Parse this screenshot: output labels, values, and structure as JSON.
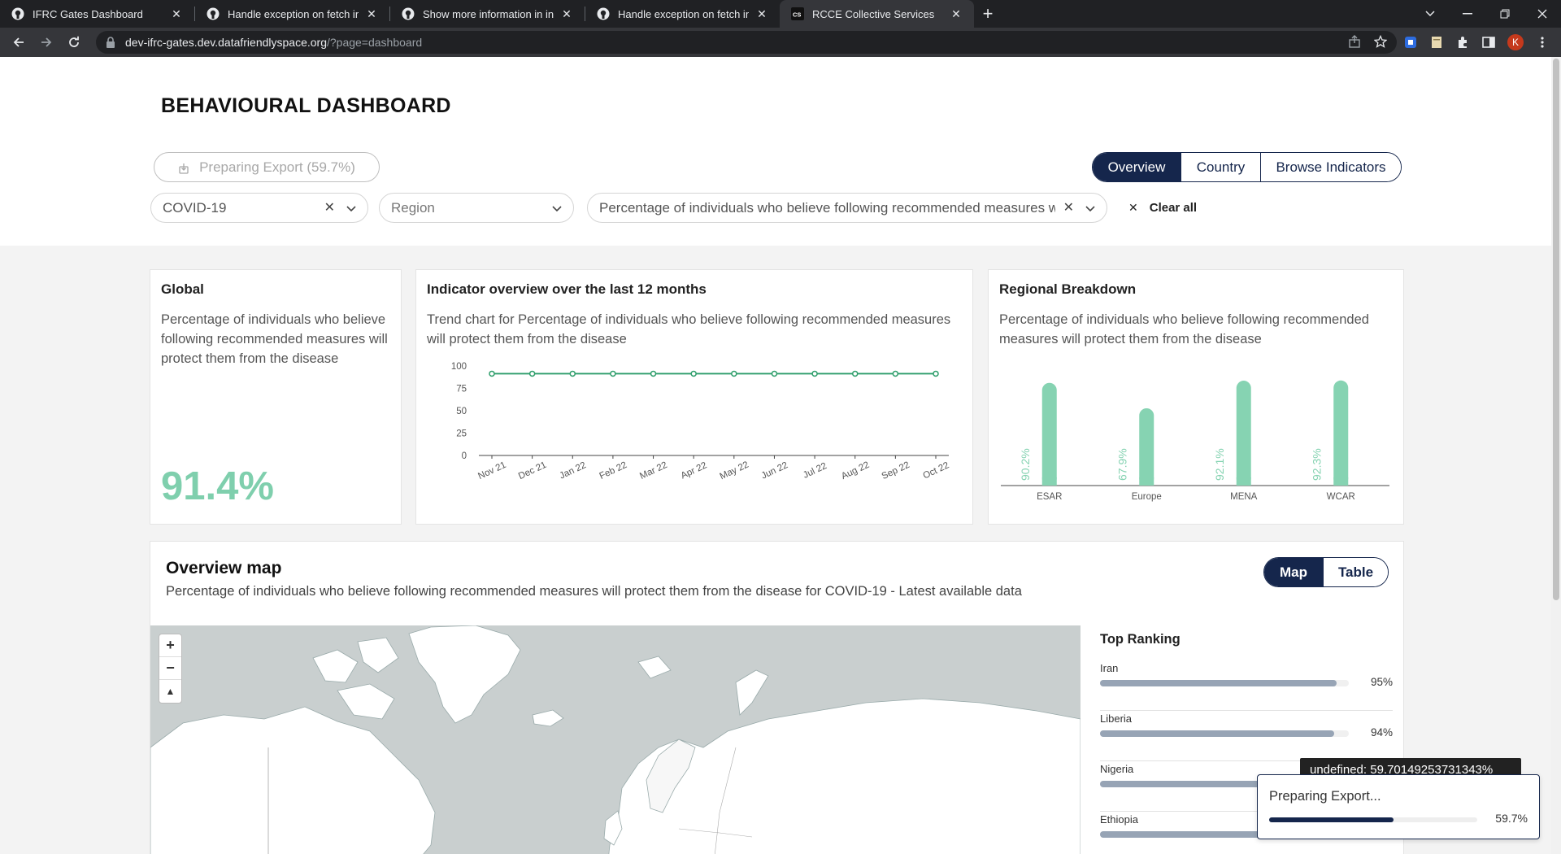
{
  "browser": {
    "tabs": [
      {
        "title": "IFRC Gates Dashboard",
        "icon": "github-icon",
        "active": false
      },
      {
        "title": "Handle exception on fetch inside",
        "icon": "github-icon",
        "active": false
      },
      {
        "title": "Show more information in indica",
        "icon": "github-icon",
        "active": false
      },
      {
        "title": "Handle exception on fetch inside",
        "icon": "github-icon",
        "active": false
      },
      {
        "title": "RCCE Collective Services",
        "icon": "cs-icon",
        "active": true
      }
    ],
    "url_host": "dev-ifrc-gates.dev.datafriendlyspace.org",
    "url_path": "/?page=dashboard",
    "profile_initial": "K"
  },
  "header": {
    "title": "BEHAVIOURAL DASHBOARD",
    "export_label": "Preparing Export (59.7%)",
    "view_tabs": [
      {
        "label": "Overview",
        "active": true
      },
      {
        "label": "Country",
        "active": false
      },
      {
        "label": "Browse Indicators",
        "active": false
      }
    ],
    "filters": {
      "disease": "COVID-19",
      "region_placeholder": "Region",
      "indicator": "Percentage of individuals who believe following recommended measures w"
    },
    "clear_all": "Clear all"
  },
  "global_card": {
    "title": "Global",
    "description": "Percentage of individuals who believe following recommended measures will protect them from the disease",
    "value": "91.4%"
  },
  "trend_card": {
    "title": "Indicator overview over the last 12 months",
    "description": "Trend chart for Percentage of individuals who believe following recommended measures will protect them from the disease"
  },
  "regional_card": {
    "title": "Regional Breakdown",
    "description": "Percentage of individuals who believe following recommended measures will protect them from the disease"
  },
  "chart_data": [
    {
      "type": "line",
      "x": [
        "Nov 21",
        "Dec 21",
        "Jan 22",
        "Feb 22",
        "Mar 22",
        "Apr 22",
        "May 22",
        "Jun 22",
        "Jul 22",
        "Aug 22",
        "Sep 22",
        "Oct 22"
      ],
      "series": [
        {
          "values": [
            91.4,
            91.4,
            91.4,
            91.4,
            91.4,
            91.4,
            91.4,
            91.4,
            91.4,
            91.4,
            91.4,
            91.4
          ]
        }
      ],
      "yticks": [
        0,
        25,
        50,
        75,
        100
      ],
      "ylim": [
        0,
        100
      ],
      "color": "#2e9e6b"
    },
    {
      "type": "bar",
      "categories": [
        "ESAR",
        "Europe",
        "MENA",
        "WCAR"
      ],
      "values": [
        90.2,
        67.9,
        92.1,
        92.3
      ],
      "labels": [
        "90.2%",
        "67.9%",
        "92.1%",
        "92.3%"
      ],
      "ylim": [
        0,
        100
      ],
      "color": "#86d3b2"
    }
  ],
  "map_card": {
    "title": "Overview map",
    "subtitle": "Percentage of individuals who believe following recommended measures will protect them from the disease for COVID-19 - Latest available data",
    "tabs": [
      {
        "label": "Map",
        "active": true
      },
      {
        "label": "Table",
        "active": false
      }
    ],
    "zoom_in": "+",
    "zoom_out": "−",
    "reset_north": "▲"
  },
  "ranking": {
    "title": "Top Ranking",
    "items": [
      {
        "name": "Iran",
        "value": "95%",
        "fraction": 0.95
      },
      {
        "name": "Liberia",
        "value": "94%",
        "fraction": 0.94
      },
      {
        "name": "Nigeria",
        "value": "",
        "fraction": 0.93
      },
      {
        "name": "Ethiopia",
        "value": "",
        "fraction": 0.92
      }
    ]
  },
  "tooltip": "undefined: 59.70149253731343%",
  "export_toast": {
    "title": "Preparing Export...",
    "value": "59.7%",
    "fraction": 0.597
  }
}
